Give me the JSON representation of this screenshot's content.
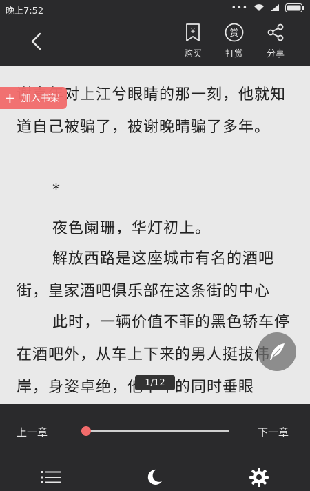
{
  "status_bar": {
    "time": "晚上7:52"
  },
  "toolbar": {
    "buy_label": "购买",
    "reward_label": "打赏",
    "reward_glyph": "赏",
    "share_label": "分享",
    "buy_glyph": "¥"
  },
  "add_to_shelf": {
    "label": "加入书架",
    "icon": "plus-icon"
  },
  "content": {
    "paragraphs": [
      "谢嘉年对上江兮眼睛的那一刻，他就知道自己被骗了，被谢晚晴骗了多年。",
      "*",
      "夜色阑珊，华灯初上。",
      "解放西路是这座城市有名的酒吧街，皇家酒吧俱乐部在这条街的中心",
      "此时，一辆价值不菲的黑色轿车停在酒吧外，从车上下来的男人挺拔伟岸，身姿卓绝，他下车的同时垂眼"
    ]
  },
  "page_indicator": "1/12",
  "chapter_nav": {
    "prev_label": "上一章",
    "next_label": "下一章",
    "progress": 0.03
  },
  "bottom_nav": {
    "icons": [
      "list-icon",
      "moon-icon",
      "gear-icon"
    ]
  },
  "colors": {
    "bar_bg": "#2a2a2c",
    "page_bg": "#e9e9e9",
    "accent": "#f26b6b",
    "text": "#222222"
  }
}
